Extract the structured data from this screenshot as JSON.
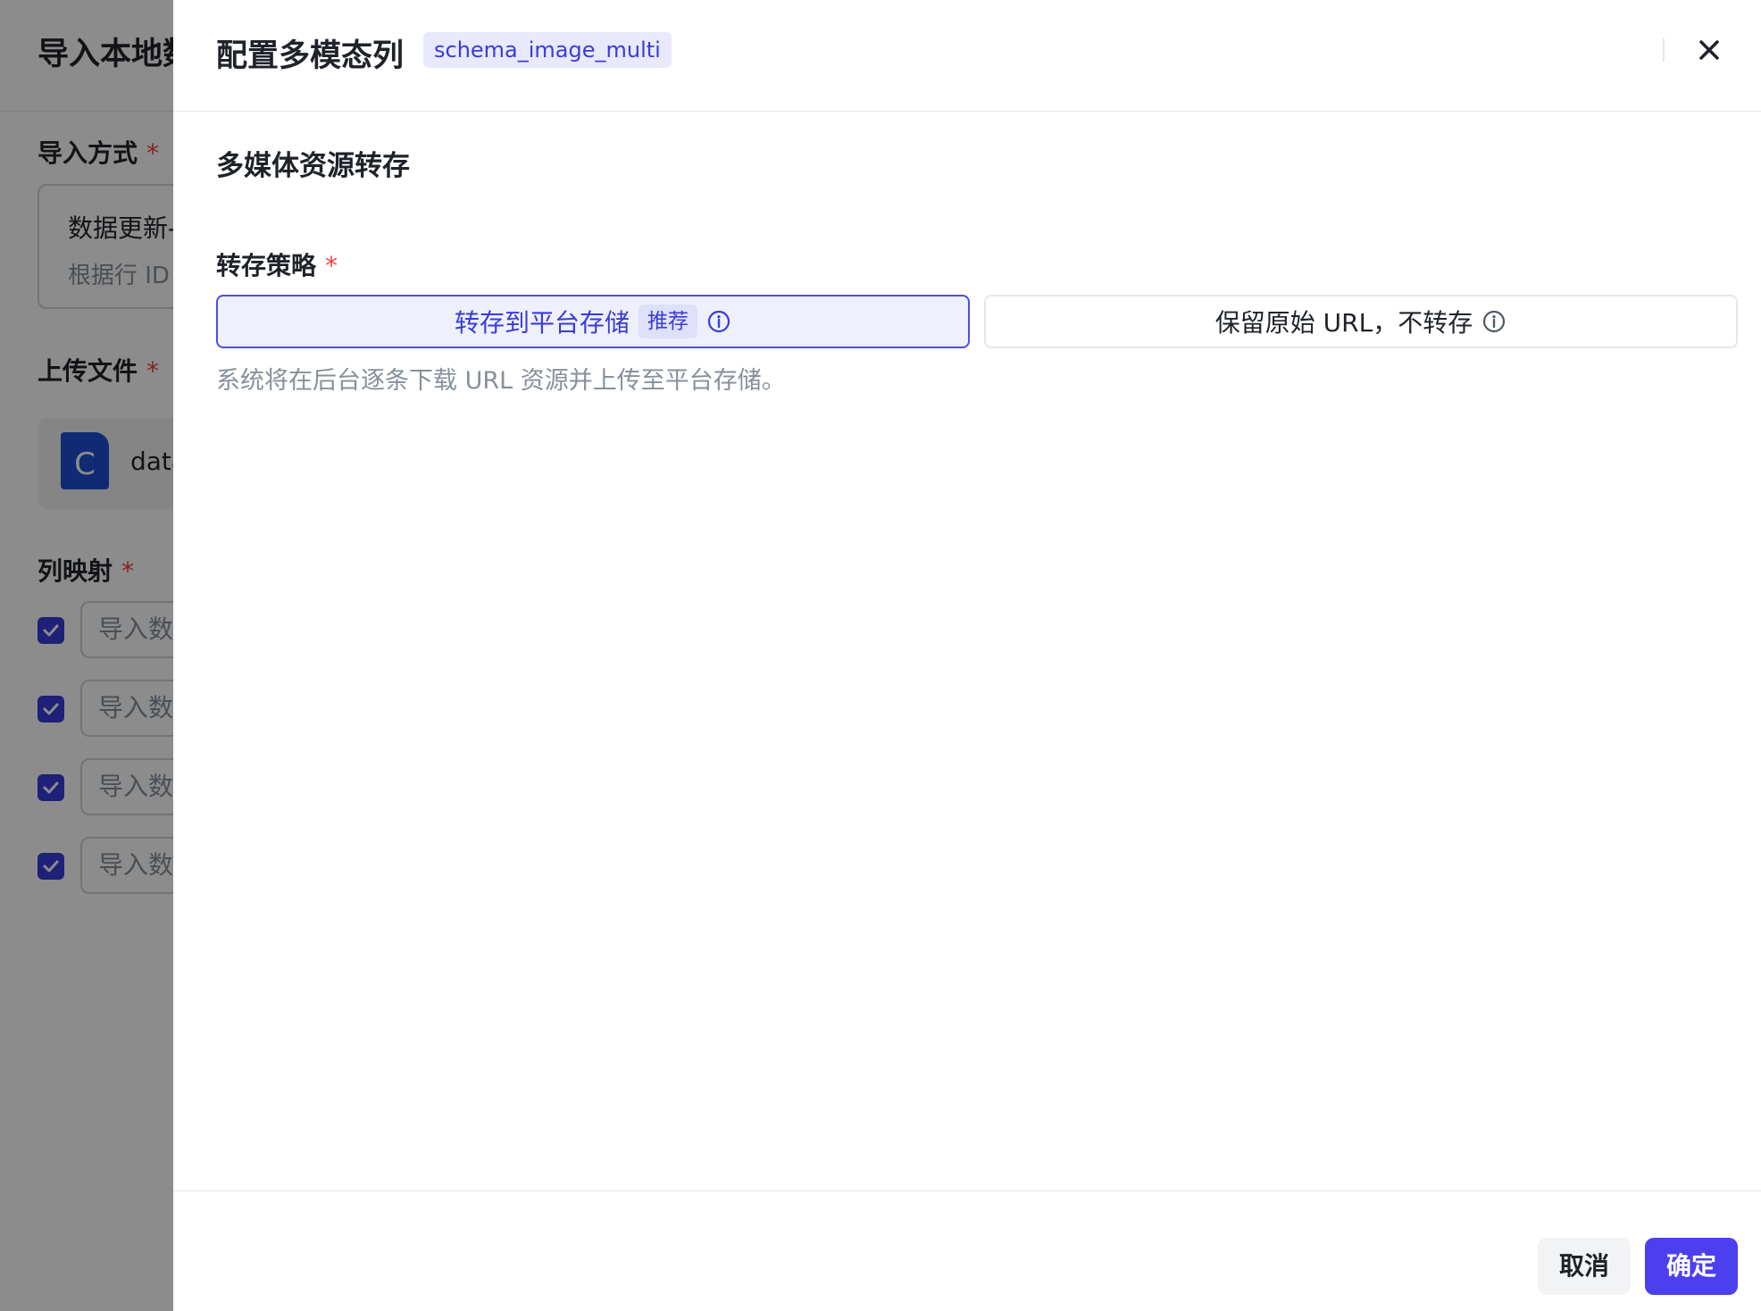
{
  "background": {
    "title": "导入本地数",
    "import_mode_label": "导入方式",
    "import_mode_value": "数据更新-",
    "import_mode_desc": "根据行 ID",
    "upload_label": "上传文件",
    "file_icon_letter": "C",
    "file_name": "data",
    "mapping_label": "列映射",
    "mapping_rows": [
      "导入数",
      "导入数",
      "导入数",
      "导入数"
    ],
    "required_mark": "*"
  },
  "drawer": {
    "title": "配置多模态列",
    "schema_tag": "schema_image_multi",
    "section_title": "多媒体资源转存",
    "field_label": "转存策略",
    "required_mark": "*",
    "options": [
      {
        "label": "转存到平台存储",
        "tag": "推荐",
        "selected": true
      },
      {
        "label": "保留原始 URL，不转存",
        "selected": false
      }
    ],
    "option_description": "系统将在后台逐条下载 URL 资源并上传至平台存储。",
    "cancel_label": "取消",
    "confirm_label": "确定"
  },
  "icons": {
    "close": "close-icon",
    "info": "info-icon",
    "checkbox": "check-icon",
    "file": "file-icon"
  },
  "colors": {
    "accent": "#4b3ff0",
    "accent_text": "#3a3bd9",
    "required": "#f53f3f",
    "muted_text": "#86909c"
  }
}
